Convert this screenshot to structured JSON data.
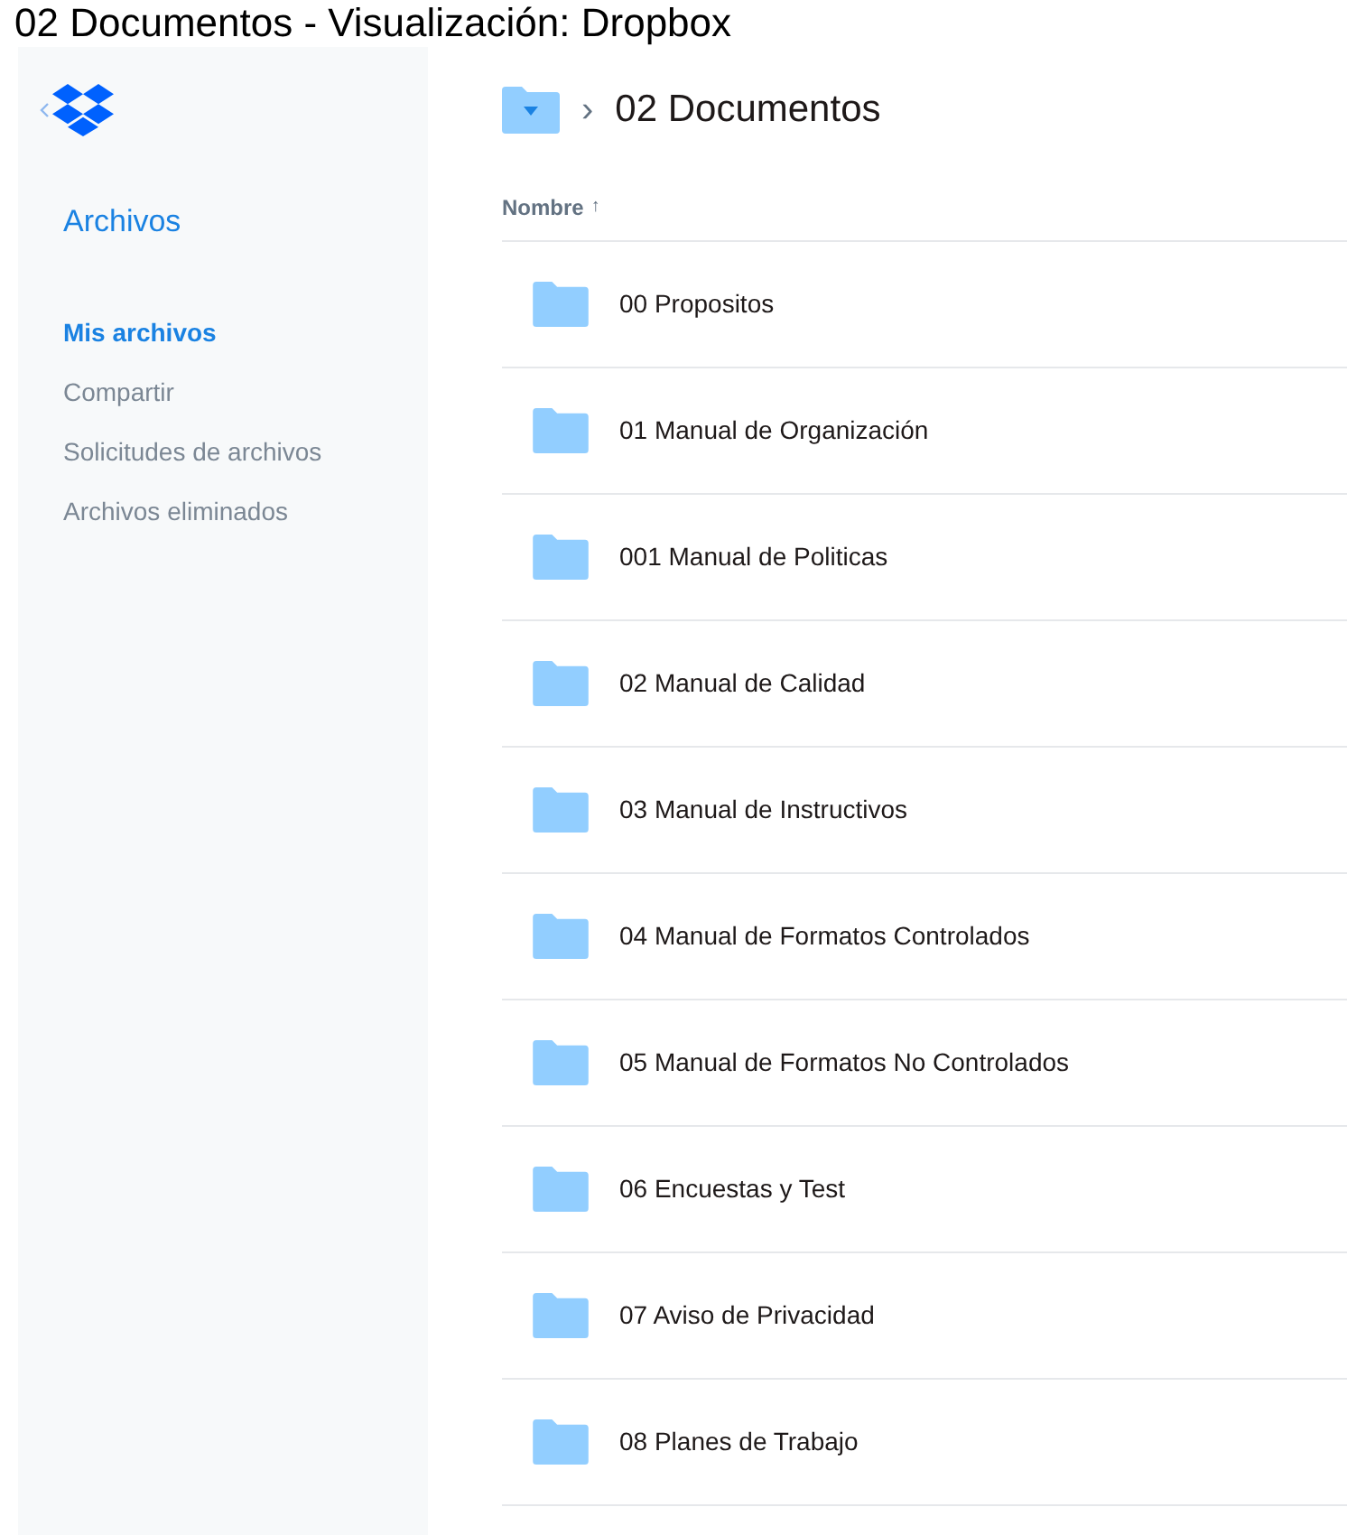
{
  "window": {
    "title": "02 Documentos - Visualización: Dropbox"
  },
  "sidebar": {
    "section": "Archivos",
    "items": [
      {
        "label": "Mis archivos",
        "selected": true
      },
      {
        "label": "Compartir",
        "selected": false
      },
      {
        "label": "Solicitudes de archivos",
        "selected": false
      },
      {
        "label": "Archivos eliminados",
        "selected": false
      }
    ]
  },
  "breadcrumb": {
    "separator": "›",
    "current": "02 Documentos"
  },
  "table": {
    "column": "Nombre",
    "sort_arrow": "↑",
    "rows": [
      {
        "name": "00 Propositos"
      },
      {
        "name": "01 Manual de Organización"
      },
      {
        "name": "001 Manual de Politicas"
      },
      {
        "name": "02 Manual de Calidad"
      },
      {
        "name": "03 Manual de Instructivos"
      },
      {
        "name": "04 Manual de Formatos Controlados"
      },
      {
        "name": "05 Manual de Formatos No Controlados"
      },
      {
        "name": "06 Encuestas y Test"
      },
      {
        "name": "07 Aviso de Privacidad"
      },
      {
        "name": "08 Planes de Trabajo"
      }
    ]
  }
}
